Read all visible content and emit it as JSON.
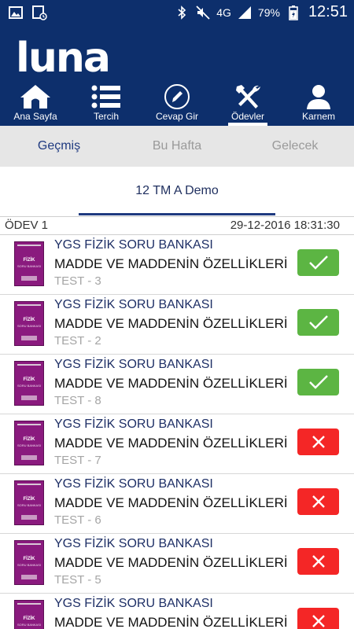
{
  "status_bar": {
    "battery_percent": "79%",
    "network": "4G",
    "time": "12:51"
  },
  "app": {
    "logo": "luna",
    "nav": [
      {
        "label": "Ana Sayfa",
        "icon": "home-icon",
        "active": false
      },
      {
        "label": "Tercih",
        "icon": "list-icon",
        "active": false
      },
      {
        "label": "Cevap Gir",
        "icon": "pencil-icon",
        "active": false
      },
      {
        "label": "Ödevler",
        "icon": "tools-icon",
        "active": true
      },
      {
        "label": "Karnem",
        "icon": "person-icon",
        "active": false
      }
    ]
  },
  "subtabs": [
    {
      "label": "Geçmiş",
      "active": true
    },
    {
      "label": "Bu Hafta",
      "active": false
    },
    {
      "label": "Gelecek",
      "active": false
    }
  ],
  "group_tab": {
    "label": "12 TM A Demo"
  },
  "homework": {
    "title": "ÖDEV 1",
    "date": "29-12-2016 18:31:30",
    "cover_text": {
      "line1": "FİZİK",
      "line2": "SORU BANKASI"
    },
    "items": [
      {
        "title": "YGS FİZİK SORU BANKASI",
        "subject": "MADDE VE MADDENİN ÖZELLİKLERİ",
        "test": "TEST - 3",
        "status": "completed"
      },
      {
        "title": "YGS FİZİK SORU BANKASI",
        "subject": "MADDE VE MADDENİN ÖZELLİKLERİ",
        "test": "TEST - 2",
        "status": "completed"
      },
      {
        "title": "YGS FİZİK SORU BANKASI",
        "subject": "MADDE VE MADDENİN ÖZELLİKLERİ",
        "test": "TEST - 8",
        "status": "completed"
      },
      {
        "title": "YGS FİZİK SORU BANKASI",
        "subject": "MADDE VE MADDENİN ÖZELLİKLERİ",
        "test": "TEST - 7",
        "status": "incomplete"
      },
      {
        "title": "YGS FİZİK SORU BANKASI",
        "subject": "MADDE VE MADDENİN ÖZELLİKLERİ",
        "test": "TEST - 6",
        "status": "incomplete"
      },
      {
        "title": "YGS FİZİK SORU BANKASI",
        "subject": "MADDE VE MADDENİN ÖZELLİKLERİ",
        "test": "TEST - 5",
        "status": "incomplete"
      },
      {
        "title": "YGS FİZİK SORU BANKASI",
        "subject": "MADDE VE MADDENİN ÖZELLİKLERİ",
        "test": "",
        "status": "incomplete"
      }
    ]
  },
  "colors": {
    "header": "#0d2f6c",
    "accent": "#1f3a80",
    "ok": "#5cb543",
    "bad": "#f42626",
    "cover": "#8a1a7e"
  }
}
